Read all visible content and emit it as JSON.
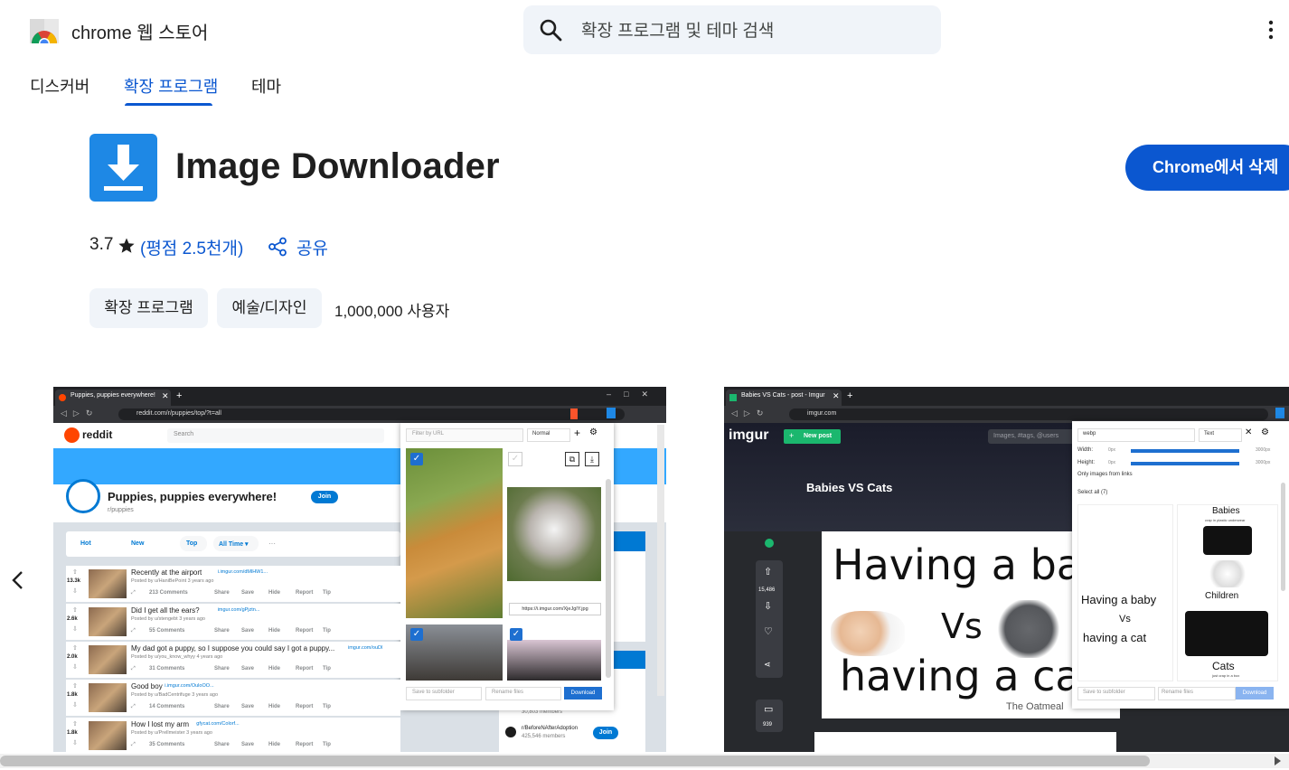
{
  "header": {
    "store_name": "chrome 웹 스토어",
    "search_placeholder": "확장 프로그램 및 테마 검색"
  },
  "nav": {
    "tabs": [
      {
        "label": "디스커버"
      },
      {
        "label": "확장 프로그램",
        "active": true
      },
      {
        "label": "테마"
      }
    ]
  },
  "extension": {
    "title": "Image Downloader",
    "remove_button": "Chrome에서 삭제",
    "rating": "3.7",
    "rating_count_link": "(평점 2.5천개)",
    "share_label": "공유",
    "chips": [
      "확장 프로그램",
      "예술/디자인"
    ],
    "users": "1,000,000 사용자"
  },
  "screenshots": {
    "reddit": {
      "tab_title": "Puppies, puppies everywhere!",
      "url": "reddit.com/r/puppies/top/?t=all",
      "logo_text": "reddit",
      "search": "Search",
      "sub_title": "Puppies, puppies everywhere!",
      "sub_name": "r/puppies",
      "join": "Join",
      "sort": [
        "Hot",
        "New",
        "Top",
        "All Time ▾",
        "···"
      ],
      "posts": [
        {
          "votes": "13.3k",
          "title": "Recently at the airport",
          "domain": "i.imgur.com/dMlHW1...",
          "meta": "Posted by u/HaniBePoint 3 years ago",
          "comments": "213 Comments"
        },
        {
          "votes": "2.6k",
          "title": "Did I get all the ears?",
          "domain": "imgur.com/gPjztn...",
          "meta": "Posted by u/stengebt 3 years ago",
          "comments": "55 Comments"
        },
        {
          "votes": "2.0k",
          "title": "My dad got a puppy, so I suppose you could say I got a puppy...",
          "domain": "imgur.com/ouDl",
          "meta": "Posted by u/you_know_whyy 4 years ago",
          "comments": "31 Comments"
        },
        {
          "votes": "1.8k",
          "title": "Good boy",
          "domain": "i.imgur.com/OuloOO...",
          "meta": "Posted by u/BadCentrifuge 3 years ago",
          "comments": "14 Comments"
        },
        {
          "votes": "1.8k",
          "title": "How I lost my arm",
          "domain": "gfycat.com/Colorf...",
          "meta": "Posted by u/Prellmeister 3 years ago",
          "comments": "35 Comments"
        }
      ],
      "actions": [
        "Share",
        "Save",
        "Hide",
        "Report",
        "Tip"
      ],
      "popup": {
        "filter_placeholder": "Filter by URL",
        "mode": "Normal",
        "url_text": "https://i.imgur.com/XjeJgIY.jpg",
        "subfolder": "Save to subfolder",
        "rename": "Rename files",
        "download": "Download"
      },
      "side": {
        "community": "r/BeforeNAfterAdoption",
        "members": "425,546 members",
        "members_top": "30,803 members",
        "join": "Join"
      }
    },
    "imgur": {
      "tab_title": "Babies VS Cats - post - Imgur",
      "url": "imgur.com",
      "logo_text": "imgur",
      "new_post": "New post",
      "search": "Images, #tags, @users",
      "post_title": "Babies VS Cats",
      "votes": "15,486",
      "comments_count": "939",
      "comic_line1": "Having a bab",
      "comic_vs": "Vs",
      "comic_line2": "having a cat",
      "comic_sign": "The Oatmeal",
      "popup": {
        "filter": "webp",
        "mode": "Text",
        "width_label": "Width:",
        "height_label": "Height:",
        "min": "0px",
        "max": "3000px",
        "only_links": "Only images from links",
        "select_all": "Select all (7)",
        "thumb1_title": "Babies",
        "thumb1_sub": "crap in plastic underwear",
        "thumb2_title": "Children",
        "thumb3_title": "Cats",
        "thumb3_sub": "just crap in a box",
        "thumb_comic_a": "Having a baby",
        "thumb_comic_vs": "Vs",
        "thumb_comic_b": "having a cat",
        "subfolder": "Save to subfolder",
        "rename": "Rename files",
        "download": "Download"
      }
    }
  },
  "colors": {
    "accent": "#0b57d0",
    "chip_bg": "#f0f4f9",
    "icon_blue": "#1e88e5",
    "reddit_orange": "#ff4500",
    "imgur_green": "#1bb76e",
    "imgur_bg": "#27292d"
  },
  "icons": [
    "chrome-logo-icon",
    "search-icon",
    "more-vert-icon",
    "download-arrow-icon",
    "star-icon",
    "share-icon",
    "chevron-left-icon",
    "scroll-right-icon"
  ]
}
